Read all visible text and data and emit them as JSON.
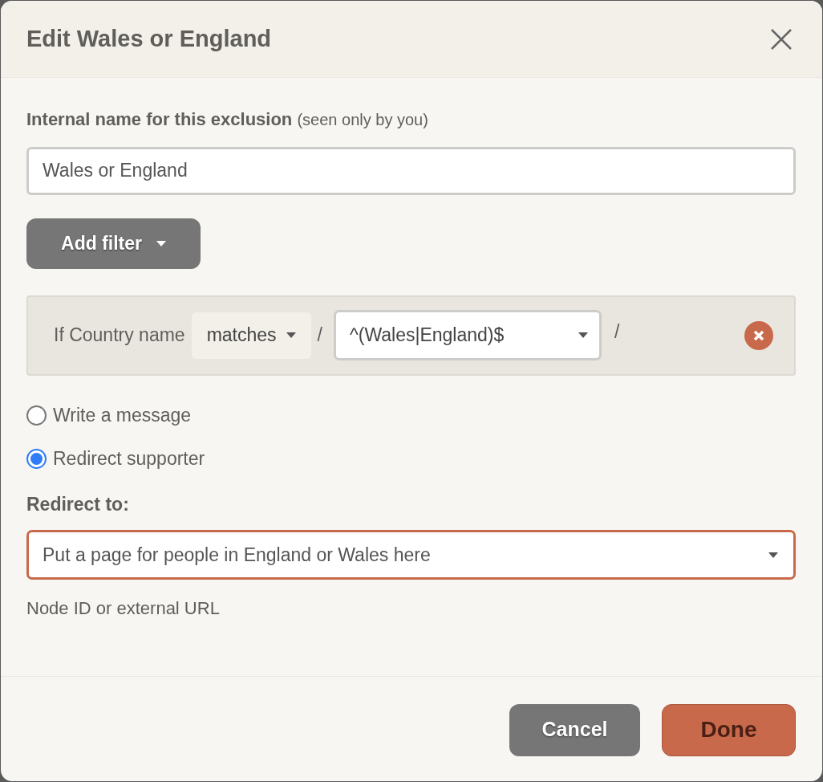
{
  "dialog": {
    "title": "Edit Wales or England"
  },
  "name_field": {
    "label": "Internal name for this exclusion",
    "hint": "(seen only by you)",
    "value": "Wales or England"
  },
  "add_filter_button": {
    "label": "Add filter"
  },
  "filter": {
    "prefix": "If Country name",
    "operator": "matches",
    "separator_1": "/",
    "pattern": "^(Wales|England)$",
    "separator_2": "/"
  },
  "options": [
    {
      "label": "Write a message",
      "selected": false
    },
    {
      "label": "Redirect supporter",
      "selected": true
    }
  ],
  "redirect": {
    "label": "Redirect to:",
    "value": "Put a page for people in England or Wales here",
    "hint": "Node ID or external URL"
  },
  "buttons": [
    {
      "label": "Cancel",
      "kind": "secondary"
    },
    {
      "label": "Done",
      "kind": "primary"
    }
  ]
}
